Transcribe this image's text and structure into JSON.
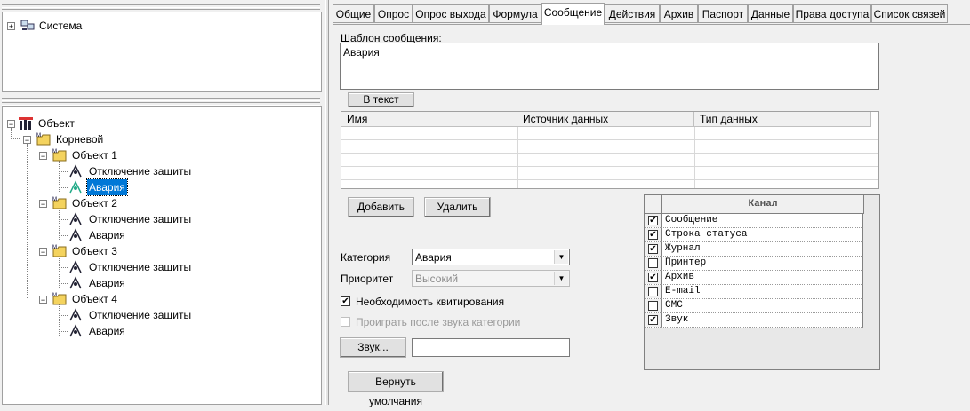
{
  "top_tree": {
    "items": [
      {
        "label": "Система",
        "icon": "computer-network-icon",
        "expander": "+"
      }
    ]
  },
  "object_tree": {
    "root": {
      "label": "Объект",
      "icon": "object-root-icon",
      "expander": "−"
    },
    "root_child": {
      "label": "Корневой",
      "icon": "folder-icon",
      "expander": "−"
    },
    "objects": [
      {
        "label": "Объект 1",
        "expander": "−",
        "children": [
          "Отключение защиты",
          "Авария"
        ],
        "selected_child": 1
      },
      {
        "label": "Объект 2",
        "expander": "−",
        "children": [
          "Отключение защиты",
          "Авария"
        ]
      },
      {
        "label": "Объект 3",
        "expander": "−",
        "children": [
          "Отключение защиты",
          "Авария"
        ]
      },
      {
        "label": "Объект 4",
        "expander": "−",
        "children": [
          "Отключение защиты",
          "Авария"
        ]
      }
    ]
  },
  "tabs": [
    {
      "label": "Общие"
    },
    {
      "label": "Опрос"
    },
    {
      "label": "Опрос выхода"
    },
    {
      "label": "Формула"
    },
    {
      "label": "Сообщение",
      "active": true
    },
    {
      "label": "Действия"
    },
    {
      "label": "Архив"
    },
    {
      "label": "Паспорт"
    },
    {
      "label": "Данные"
    },
    {
      "label": "Права доступа"
    },
    {
      "label": "Список связей"
    }
  ],
  "message": {
    "template_label": "Шаблон сообщения:",
    "template_value": "Авария",
    "to_text_button": "В текст",
    "table_headers": [
      "Имя",
      "Источник данных",
      "Тип данных"
    ],
    "add_button": "Добавить",
    "delete_button": "Удалить",
    "category_label": "Категория",
    "category_value": "Авария",
    "priority_label": "Приоритет",
    "priority_value": "Высокий",
    "ack_required_label": "Необходимость квитирования",
    "ack_required_checked": true,
    "play_after_label": "Проиграть после звука категории",
    "play_after_checked": false,
    "sound_button": "Звук...",
    "sound_value": "",
    "restore_defaults_button": "Вернуть умолчания"
  },
  "channels": {
    "header": "Канал",
    "items": [
      {
        "label": "Сообщение",
        "checked": true
      },
      {
        "label": "Строка статуса",
        "checked": true
      },
      {
        "label": "Журнал",
        "checked": true
      },
      {
        "label": "Принтер",
        "checked": false
      },
      {
        "label": "Архив",
        "checked": true
      },
      {
        "label": "E-mail",
        "checked": false
      },
      {
        "label": "СМС",
        "checked": false
      },
      {
        "label": "Звук",
        "checked": true
      }
    ]
  },
  "colors": {
    "selection": "#0078d7",
    "grid_line": "#d8d8d8"
  }
}
